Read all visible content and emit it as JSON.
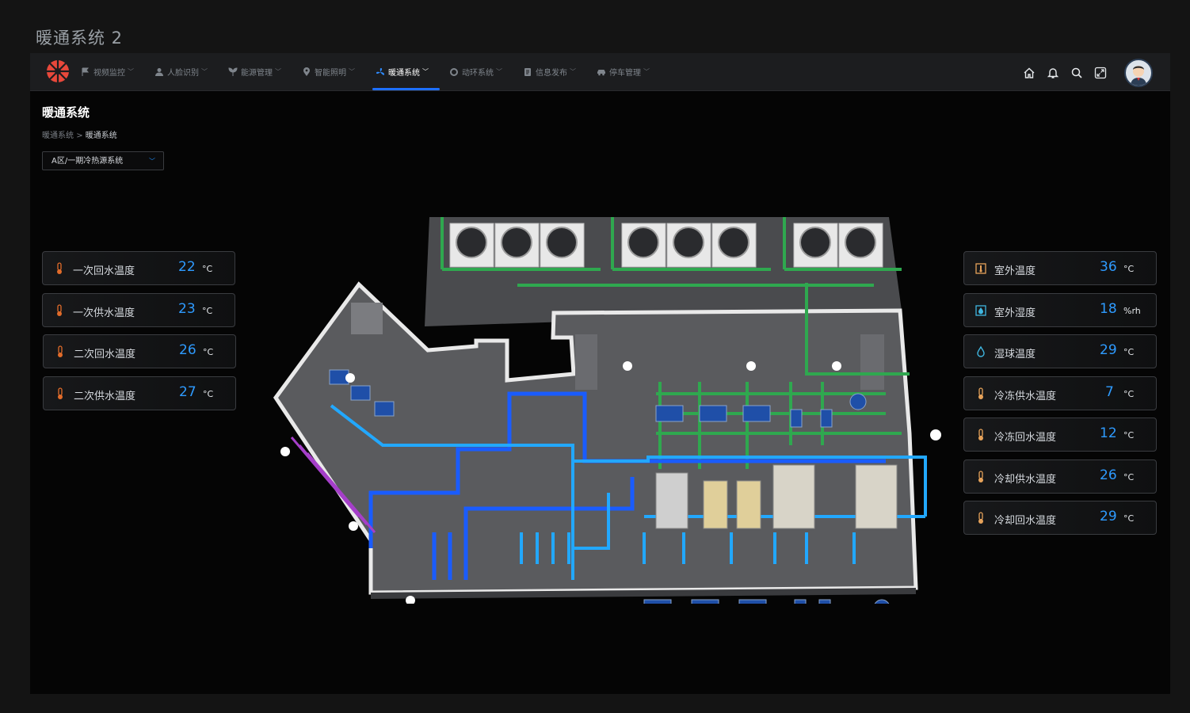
{
  "window_title": "暖通系统 2",
  "nav": {
    "items": [
      {
        "label": "视频监控",
        "icon": "flag-icon"
      },
      {
        "label": "人脸识别",
        "icon": "person-icon"
      },
      {
        "label": "能源管理",
        "icon": "leaf-icon"
      },
      {
        "label": "智能照明",
        "icon": "location-pin-icon"
      },
      {
        "label": "暖通系统",
        "icon": "fan-icon",
        "active": true
      },
      {
        "label": "动环系统",
        "icon": "ring-icon"
      },
      {
        "label": "信息发布",
        "icon": "document-icon"
      },
      {
        "label": "停车管理",
        "icon": "car-icon"
      }
    ]
  },
  "tools": [
    "home-icon",
    "bell-icon",
    "search-icon",
    "fullscreen-icon"
  ],
  "header": {
    "title": "暖通系统"
  },
  "breadcrumb": {
    "parent": "暖通系统",
    "separator": ">",
    "current": "暖通系统"
  },
  "system_select": {
    "value": "A区/一期冷热源系统"
  },
  "left_cards": [
    {
      "label": "一次回水温度",
      "value": "22",
      "unit": "°C"
    },
    {
      "label": "一次供水温度",
      "value": "23",
      "unit": "°C"
    },
    {
      "label": "二次回水温度",
      "value": "26",
      "unit": "°C"
    },
    {
      "label": "二次供水温度",
      "value": "27",
      "unit": "°C"
    }
  ],
  "right_cards": [
    {
      "label": "室外温度",
      "value": "36",
      "unit": "°C",
      "icon": "thermometer-box-icon"
    },
    {
      "label": "室外湿度",
      "value": "18",
      "unit": "%rh",
      "icon": "humidity-box-icon"
    },
    {
      "label": "湿球温度",
      "value": "29",
      "unit": "°C",
      "icon": "droplet-icon"
    },
    {
      "label": "冷冻供水温度",
      "value": "7",
      "unit": "°C",
      "icon": "thermometer-icon"
    },
    {
      "label": "冷冻回水温度",
      "value": "12",
      "unit": "°C",
      "icon": "thermometer-icon"
    },
    {
      "label": "冷却供水温度",
      "value": "26",
      "unit": "°C",
      "icon": "thermometer-icon"
    },
    {
      "label": "冷却回水温度",
      "value": "29",
      "unit": "°C",
      "icon": "thermometer-icon"
    }
  ],
  "colors": {
    "accent": "#1e6fff",
    "value": "#2e9bff",
    "pipe_supply": "#1a5cff",
    "pipe_return": "#22a8ff",
    "pipe_cooling": "#2fa84f",
    "pipe_other": "#a53fc9",
    "thermo": "#e06b2a"
  }
}
